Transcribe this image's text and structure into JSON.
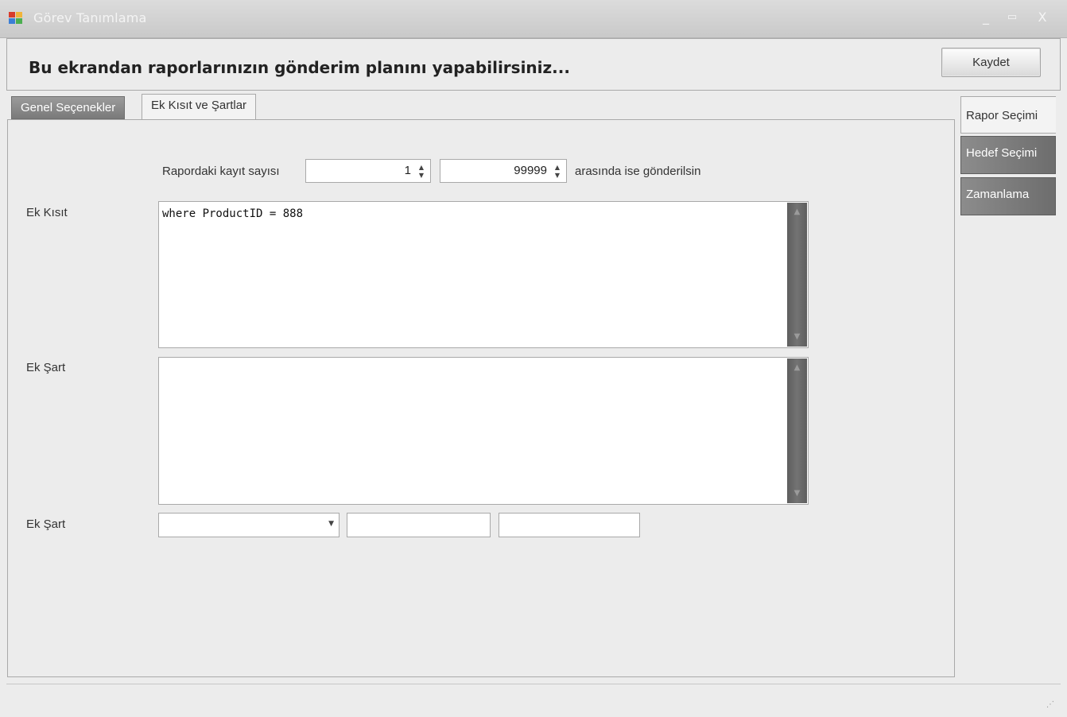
{
  "window": {
    "title": "Görev Tanımlama",
    "minimize_glyph": "_",
    "maximize_glyph": "▭",
    "close_glyph": "X"
  },
  "header": {
    "title": "Bu ekrandan raporlarınızın gönderim planını yapabilirsiniz...",
    "save_button": "Kaydet"
  },
  "tabs": [
    {
      "label": "Genel Seçenekler",
      "active": false
    },
    {
      "label": "Ek Kısıt ve Şartlar",
      "active": true
    }
  ],
  "form": {
    "record_count_label": "Rapordaki kayıt sayısı",
    "min_value": "1",
    "max_value": "99999",
    "between_text": "arasında ise gönderilsin",
    "constraint_label": "Ek Kısıt",
    "constraint_text": "where ProductID = 888",
    "condition_label": "Ek Şart",
    "condition_text": "",
    "condition2_label": "Ek Şart",
    "condition2_combo_value": "",
    "condition2_field1": "",
    "condition2_field2": ""
  },
  "side_tabs": [
    {
      "label": "Rapor Seçimi",
      "active": true
    },
    {
      "label": "Hedef Seçimi",
      "active": false
    },
    {
      "label": "Zamanlama",
      "active": false
    }
  ],
  "icons": {
    "spin_up": "▲",
    "spin_down": "▼",
    "scroll_up": "▲",
    "scroll_down": "▼",
    "combo_down": "▼",
    "size_grip": "⋰"
  },
  "colors": {
    "title_bar": "#cfcfcf",
    "inactive_tab": "#8a8a8a",
    "scrollbar": "#666666"
  }
}
